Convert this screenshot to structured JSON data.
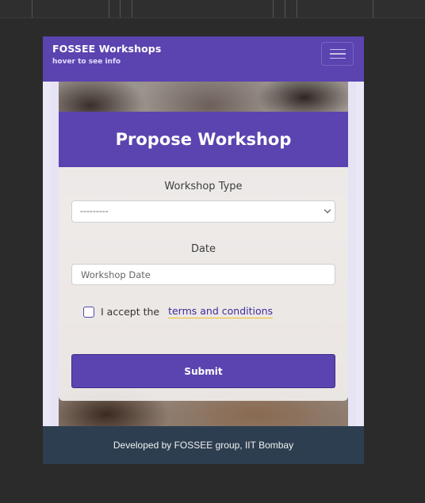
{
  "navbar": {
    "brand": "FOSSEE Workshops",
    "subtitle": "hover to see info",
    "toggle_icon": "hamburger-icon"
  },
  "card": {
    "title": "Propose Workshop",
    "workshop_type_label": "Workshop Type",
    "workshop_type_value": "---------",
    "date_label": "Date",
    "date_placeholder": "Workshop Date",
    "accept_text": "I accept the",
    "terms_link": "terms and conditions",
    "submit_label": "Submit"
  },
  "footer": {
    "text": "Developed by FOSSEE group, IIT Bombay"
  },
  "colors": {
    "primary": "#5b44b0",
    "footer_bg": "#2d3e50",
    "link_underline": "#f0c11c"
  }
}
